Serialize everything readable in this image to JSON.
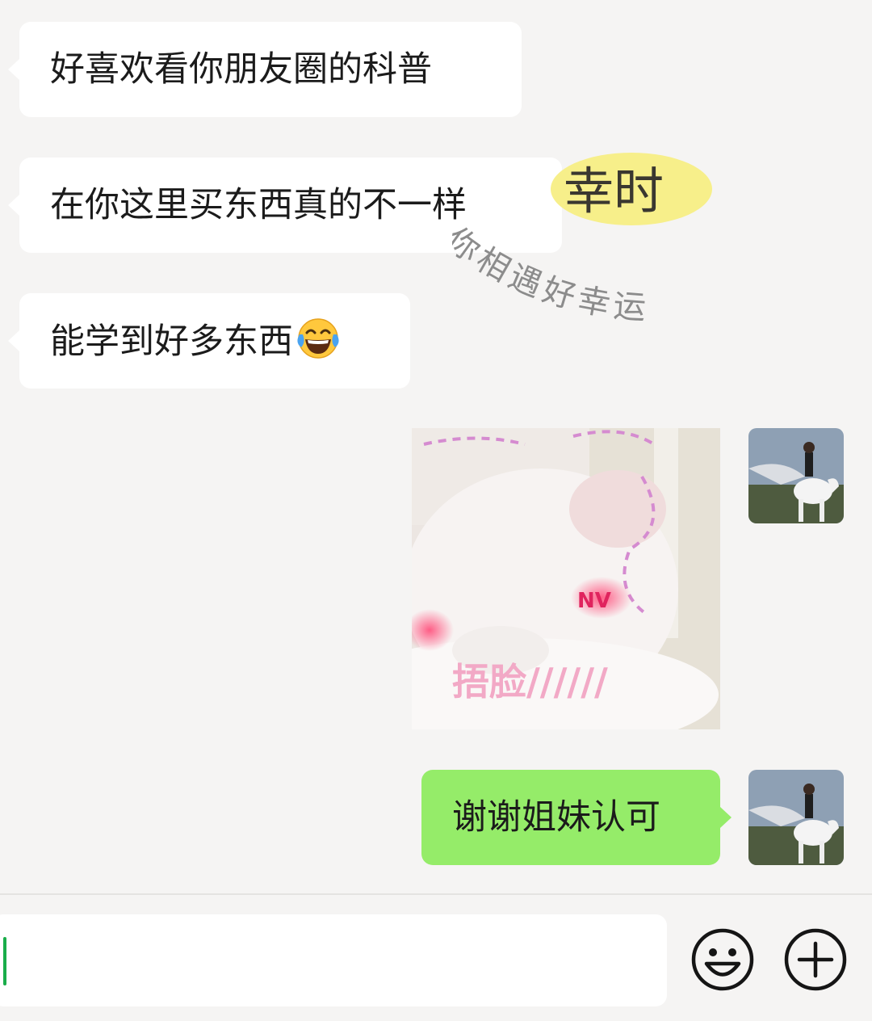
{
  "messages": [
    {
      "side": "left",
      "text": "好喜欢看你朋友圈的科普"
    },
    {
      "side": "left",
      "text": "在你这里买东西真的不一样"
    },
    {
      "side": "left",
      "text": "能学到好多东西"
    },
    {
      "side": "right",
      "type": "sticker",
      "text": "捂脸//////"
    },
    {
      "side": "right",
      "text": "谢谢姐妹认可"
    }
  ],
  "overlay": {
    "highlight_text": "幸时",
    "arc_text": "你相遇好幸运"
  },
  "sticker": {
    "caption": "捂脸//////",
    "mark": "NV"
  },
  "icons": {
    "laugh_emoji": "tears-of-joy-icon",
    "emoji_button": "smiley-icon",
    "more_button": "plus-circle-icon"
  },
  "colors": {
    "bubble_left": "#ffffff",
    "bubble_right": "#95ec69",
    "background": "#f5f4f3",
    "caret": "#1aad4a",
    "highlight": "#f7ef8a"
  }
}
